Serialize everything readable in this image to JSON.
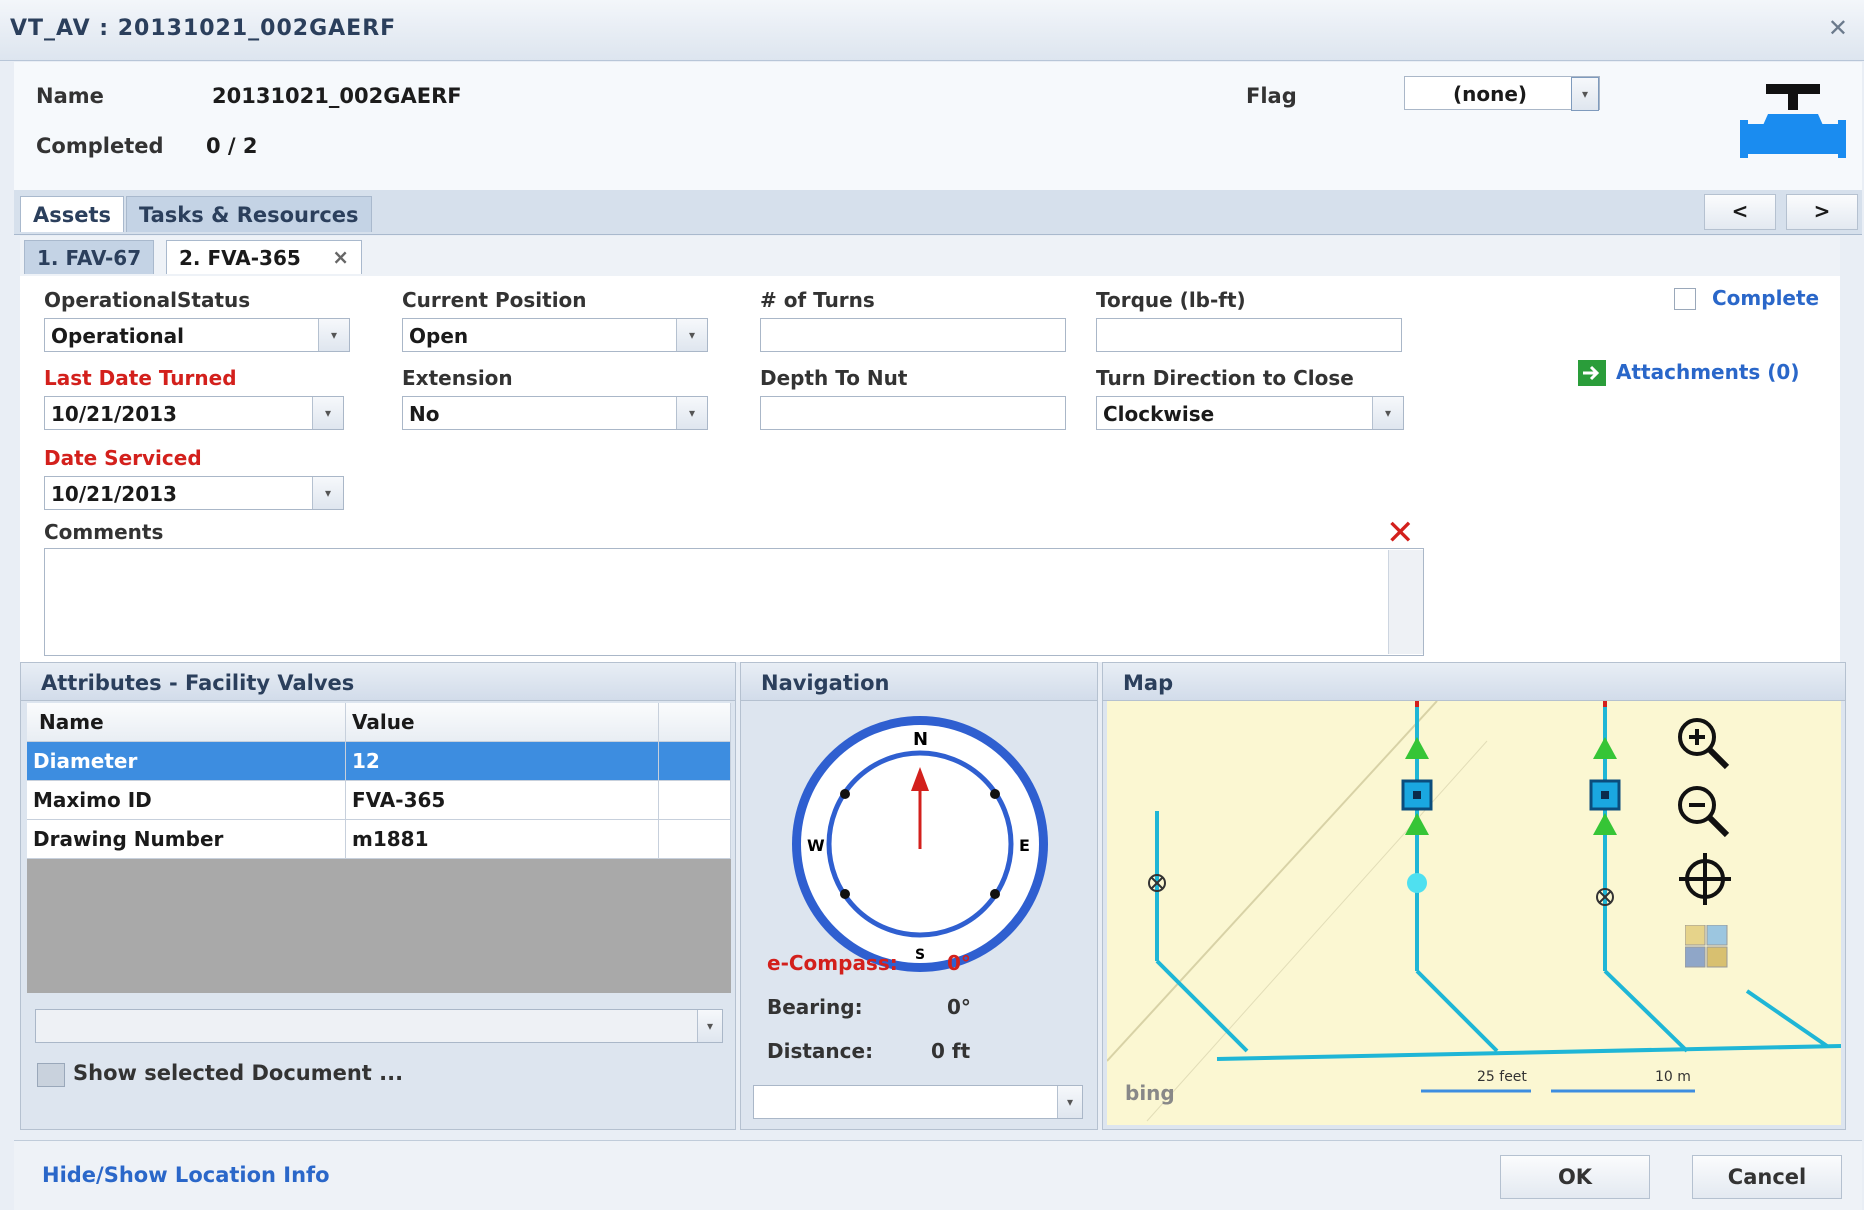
{
  "window": {
    "title": "VT_AV :  20131021_002GAERF",
    "close_glyph": "✕"
  },
  "header": {
    "name_label": "Name",
    "name_value": "20131021_002GAERF",
    "completed_label": "Completed",
    "completed_value": "0 / 2",
    "flag_label": "Flag",
    "flag_value": "(none)",
    "asset_icon": "valve-icon"
  },
  "tabs": [
    {
      "label": "Assets"
    },
    {
      "label": "Tasks & Resources"
    }
  ],
  "pager": {
    "prev": "<",
    "next": ">"
  },
  "asset_tabs": [
    {
      "label": "1. FAV-67"
    },
    {
      "label": "2. FVA-365"
    }
  ],
  "asset_tab_close": "×",
  "form": {
    "operational_status_label": "OperationalStatus",
    "operational_status_value": "Operational",
    "current_position_label": "Current Position",
    "current_position_value": "Open",
    "turns_label": "# of Turns",
    "turns_value": "",
    "torque_label": "Torque (lb-ft)",
    "torque_value": "",
    "complete_label": "Complete",
    "attachments_label": "Attachments (0)",
    "last_date_turned_label": "Last Date Turned",
    "last_date_turned_value": "10/21/2013",
    "extension_label": "Extension",
    "extension_value": "No",
    "depth_label": "Depth To Nut",
    "depth_value": "",
    "turn_direction_label": "Turn Direction to Close",
    "turn_direction_value": "Clockwise",
    "date_serviced_label": "Date Serviced",
    "date_serviced_value": "10/21/2013",
    "comments_label": "Comments",
    "comments_value": ""
  },
  "attributes": {
    "title": "Attributes - Facility Valves",
    "columns": [
      "Name",
      "Value"
    ],
    "rows": [
      {
        "name": "Diameter",
        "value": "12"
      },
      {
        "name": "Maximo ID",
        "value": "FVA-365"
      },
      {
        "name": "Drawing Number",
        "value": "m1881"
      }
    ],
    "document_dropdown": "",
    "show_document": "Show selected Document ..."
  },
  "navigation": {
    "title": "Navigation",
    "compass_n": "N",
    "compass_s": "S",
    "compass_e": "E",
    "compass_w": "W",
    "ecompass_label": "e-Compass:",
    "ecompass_value": "0°",
    "bearing_label": "Bearing:",
    "bearing_value": "0°",
    "distance_label": "Distance:",
    "distance_value": "0 ft",
    "dropdown_value": ""
  },
  "map": {
    "title": "Map",
    "brand": "bing",
    "scale_feet": "25 feet",
    "scale_meters": "10 m",
    "tools": [
      "zoom-in-icon",
      "zoom-out-icon",
      "locate-icon",
      "layers-icon"
    ]
  },
  "footer": {
    "hide_show_link": "Hide/Show Location Info",
    "ok_label": "OK",
    "cancel_label": "Cancel"
  },
  "colors": {
    "accent": "#2a67c9",
    "required": "#d3201c",
    "selected_row": "#3d8de0",
    "pipe": "#1fb6d6"
  }
}
